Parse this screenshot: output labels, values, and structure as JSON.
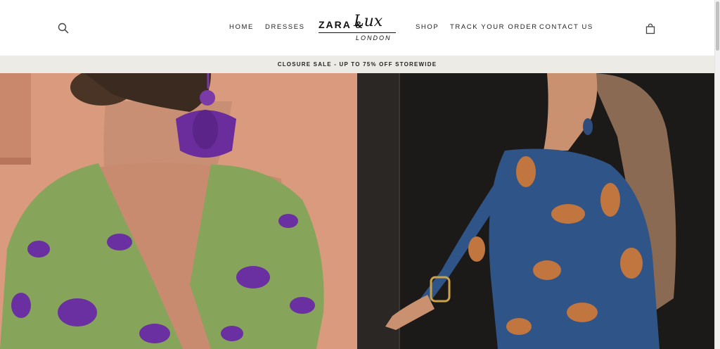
{
  "header": {
    "search_icon": "search-icon",
    "cart_icon": "shopping-bag-icon",
    "nav": {
      "home": "HOME",
      "dresses": "DRESSES",
      "shop": "SHOP",
      "track": "TRACK YOUR ORDER",
      "contact": "CONTACT US"
    },
    "logo": {
      "brand": "ZARA &",
      "script": "Lux",
      "city": "LONDON"
    }
  },
  "announcement": {
    "text": "CLOSURE SALE - UP TO 75% OFF STOREWIDE"
  },
  "colors": {
    "announcement_bg": "#edebe6",
    "left_backdrop": "#d99a7e",
    "right_backdrop": "#1c1a19",
    "green_dress": "#86a55a",
    "purple_print": "#6a2fa0",
    "blue_dress": "#2f5487",
    "rust_print": "#c0763e"
  }
}
